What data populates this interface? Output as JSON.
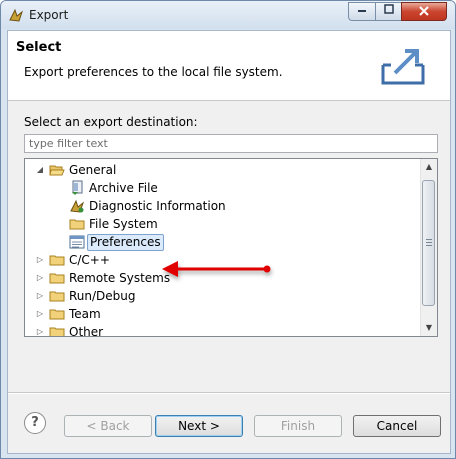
{
  "window": {
    "title": "Export"
  },
  "header": {
    "title": "Select",
    "description": "Export preferences to the local file system."
  },
  "main": {
    "destination_label": "Select an export destination:",
    "filter_placeholder": "type filter text",
    "filter_value": "",
    "tree": [
      {
        "label": "General",
        "expanded": true,
        "icon": "folder-open-icon"
      },
      {
        "label": "Archive File",
        "icon": "archive-file-icon"
      },
      {
        "label": "Diagnostic Information",
        "icon": "diagnostic-icon"
      },
      {
        "label": "File System",
        "icon": "folder-icon"
      },
      {
        "label": "Preferences",
        "icon": "preferences-icon",
        "selected": true
      },
      {
        "label": "C/C++",
        "expanded": false,
        "icon": "folder-icon"
      },
      {
        "label": "Remote Systems",
        "expanded": false,
        "icon": "folder-icon"
      },
      {
        "label": "Run/Debug",
        "expanded": false,
        "icon": "folder-icon"
      },
      {
        "label": "Team",
        "expanded": false,
        "icon": "folder-icon"
      },
      {
        "label": "Other",
        "expanded": false,
        "icon": "folder-icon"
      }
    ]
  },
  "footer": {
    "help": "?",
    "back": "< Back",
    "next": "Next >",
    "finish": "Finish",
    "cancel": "Cancel"
  },
  "colors": {
    "arrow": "#e00000",
    "selection": "#dcebfc",
    "close_button": "#c9452f"
  }
}
